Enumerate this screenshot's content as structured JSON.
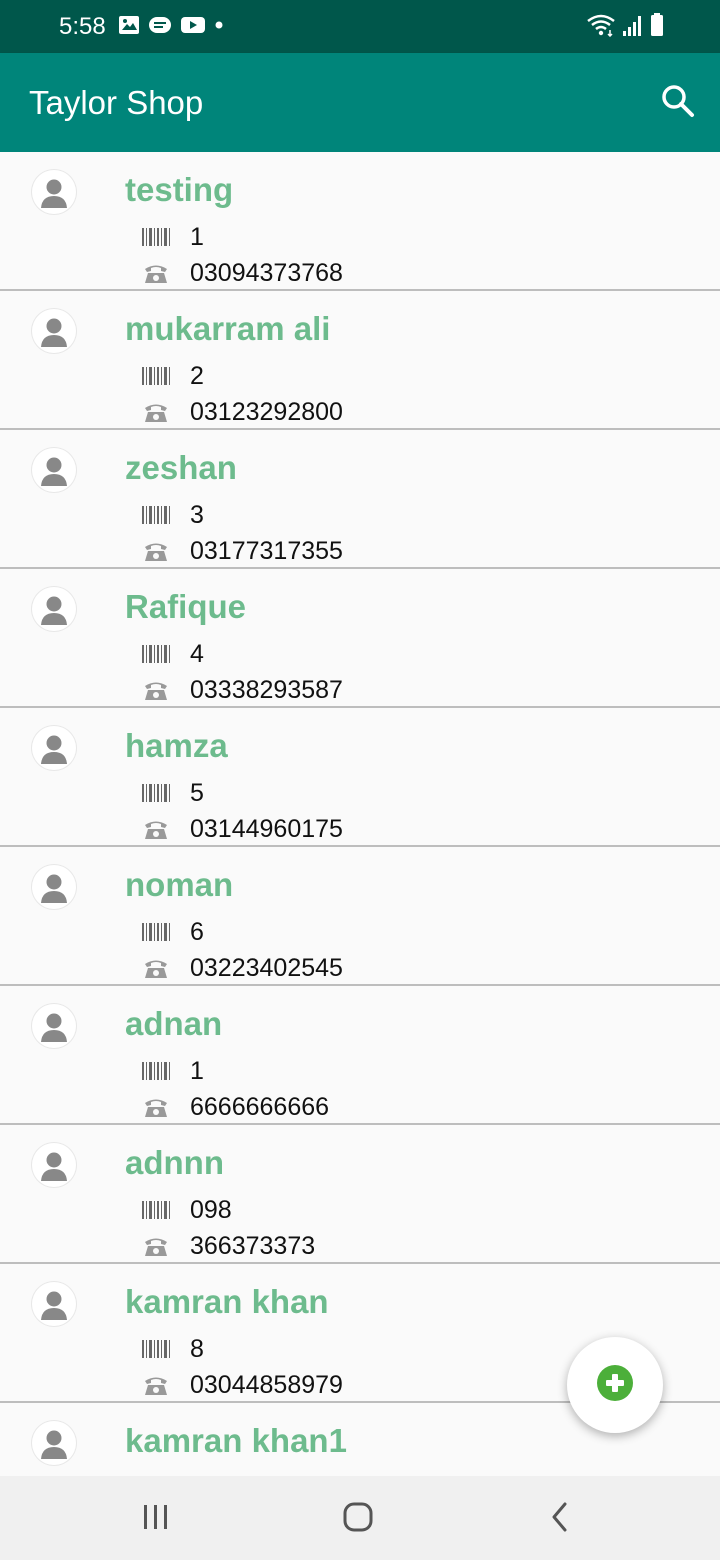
{
  "status_bar": {
    "time": "5:58",
    "left_icons": [
      "image-icon",
      "message-icon",
      "youtube-icon",
      "dot-icon"
    ],
    "right_icons": [
      "wifi-icon",
      "signal-icon",
      "battery-icon"
    ]
  },
  "app_bar": {
    "title": "Taylor Shop",
    "search_icon": "search-icon",
    "background": "#00857a"
  },
  "colors": {
    "status_bar": "#00574b",
    "name_text": "#6dbb8d",
    "fab_icon": "#4caf3a"
  },
  "customers": [
    {
      "name": "testing",
      "code": "1",
      "phone": "03094373768"
    },
    {
      "name": "mukarram ali",
      "code": "2",
      "phone": "03123292800"
    },
    {
      "name": "zeshan",
      "code": "3",
      "phone": "03177317355"
    },
    {
      "name": "Rafique",
      "code": "4",
      "phone": "03338293587"
    },
    {
      "name": "hamza",
      "code": "5",
      "phone": "03144960175"
    },
    {
      "name": "noman",
      "code": "6",
      "phone": "03223402545"
    },
    {
      "name": "adnan",
      "code": "1",
      "phone": "6666666666"
    },
    {
      "name": "adnnn",
      "code": "098",
      "phone": "366373373"
    },
    {
      "name": "kamran khan",
      "code": "8",
      "phone": "03044858979"
    },
    {
      "name": "kamran khan1",
      "code": "",
      "phone": ""
    }
  ],
  "fab": {
    "icon": "add-circle-icon"
  },
  "nav_bar": {
    "icons": [
      "recents-icon",
      "home-icon",
      "back-icon"
    ]
  }
}
